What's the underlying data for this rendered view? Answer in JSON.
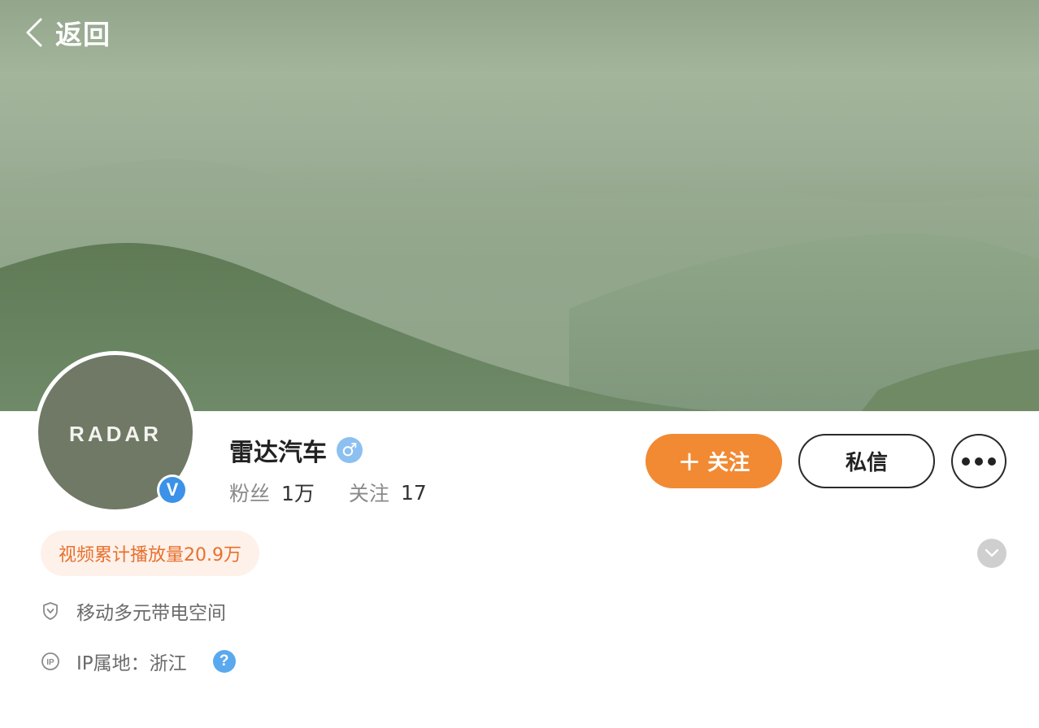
{
  "header": {
    "back_label": "返回",
    "back_icon": "chevron-left-icon"
  },
  "cover": {
    "description_colors": {
      "sky": "#a3b59b",
      "hills_near": "#5e7a55",
      "hills_far": "#7f977a"
    }
  },
  "profile": {
    "avatar_text": "RADAR",
    "verified_badge": "V",
    "name": "雷达汽车",
    "gender_symbol": "♂",
    "followers_label": "粉丝",
    "followers_value": "1万",
    "following_label": "关注",
    "following_value": "17"
  },
  "actions": {
    "follow_plus": "+",
    "follow_label": "关注",
    "message_label": "私信",
    "more_icon": "more-dots-icon"
  },
  "stats_pill": {
    "text": "视频累计播放量20.9万"
  },
  "info": {
    "bio": "移动多元带电空间",
    "ip_location": "IP属地：浙江",
    "help_symbol": "?"
  },
  "colors": {
    "accent_orange": "#f18a33",
    "pill_bg": "#fdf1ea",
    "pill_text": "#e8702d",
    "verify_blue": "#3b92e8",
    "help_blue": "#5aa9ef"
  }
}
